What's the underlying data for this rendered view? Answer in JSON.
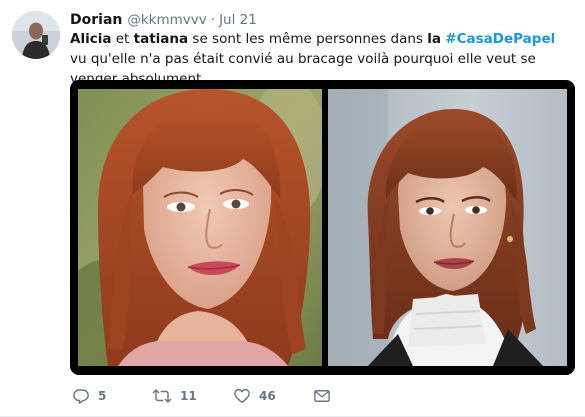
{
  "tweet": {
    "author_name": "Dorian",
    "author_handle": "@kkmmvvv",
    "separator": "·",
    "time": "Jul 21",
    "text": {
      "w1": "Alicia",
      "w2": " et ",
      "w3": "tatiana",
      "w4": " se sont les même personnes dans ",
      "w5": "la",
      "w6": " ",
      "hashtag": "#CasaDePapel",
      "w7": " vu qu'elle n'a pas était convié au bracage voilà pourquoi elle veut se venger absolument"
    },
    "media": {
      "left_photo_icon": "portrait-photo",
      "right_photo_icon": "portrait-photo"
    },
    "actions": {
      "reply_count": "5",
      "retweet_count": "11",
      "like_count": "46",
      "reply_icon": "speech-bubble-icon",
      "retweet_icon": "retweet-icon",
      "like_icon": "heart-icon",
      "dm_icon": "envelope-icon"
    }
  },
  "colors": {
    "text": "#14171a",
    "muted": "#657786",
    "link": "#1b95e0",
    "icon": "#657786",
    "border": "#e6ecf0"
  }
}
